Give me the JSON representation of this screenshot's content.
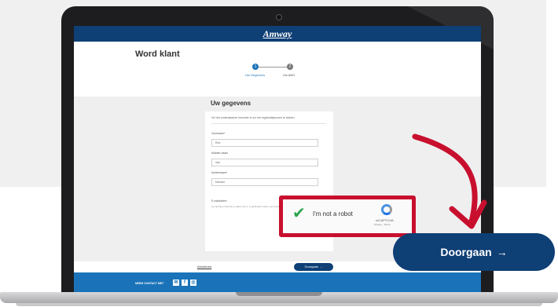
{
  "app": {
    "logo": "Amway"
  },
  "page": {
    "title": "Word klant"
  },
  "steps": [
    {
      "number": "1",
      "label": "Uw Gegevens"
    },
    {
      "number": "2",
      "label": "Uw ABO"
    }
  ],
  "form": {
    "section_title": "Uw gegevens",
    "intro": "Vul het onderstaande formulier in om het registratieproces te starten.",
    "fields": [
      {
        "label": "Voornaam*",
        "value": "Rob"
      },
      {
        "label": "Midden naam",
        "value": "Van"
      },
      {
        "label": "Achternaam*",
        "value": "Demme"
      },
      {
        "label": "E-mailadres*",
        "value": ""
      }
    ],
    "email_hint": "we zijn blij om kennis te maken met u, zo gebruiken zodat u een Amway account"
  },
  "recaptcha": {
    "label": "I'm not a robot",
    "brand": "reCAPTCHA",
    "terms": "Privacy - Terms"
  },
  "actions": {
    "cancel": "Annuleren",
    "continue_small": "Doorgaan",
    "continue_arrow": "→"
  },
  "footer": {
    "contact": "NEEM CONTACT MET",
    "icons": [
      "mail-icon",
      "facebook-icon",
      "instagram-icon"
    ]
  },
  "callout": {
    "label": "Doorgaan",
    "arrow": "→"
  },
  "colors": {
    "brand_blue": "#0e3f75",
    "highlight_red": "#c8102e",
    "footer_blue": "#1a73b9",
    "check_green": "#2ea44f"
  }
}
